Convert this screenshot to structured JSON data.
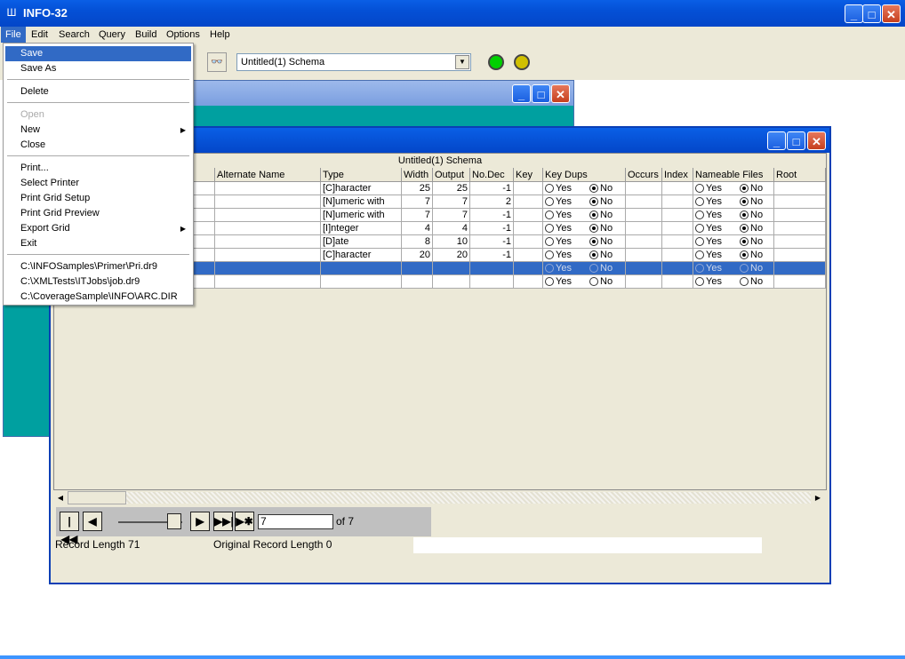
{
  "app": {
    "title": "INFO-32"
  },
  "menubar": [
    "File",
    "Edit",
    "Search",
    "Query",
    "Build",
    "Options",
    "Help"
  ],
  "toolbar": {
    "schema_selector": "Untitled(1) Schema"
  },
  "file_menu": {
    "items": [
      "Save",
      "Save As",
      "Delete",
      "Open",
      "New",
      "Close",
      "Print...",
      "Select Printer",
      "Print Grid Setup",
      "Print Grid Preview",
      "Export Grid",
      "Exit"
    ],
    "recent": [
      "C:\\INFOSamples\\Primer\\Pri.dr9",
      "C:\\XMLTests\\ITJobs\\job.dr9",
      "C:\\CoverageSample\\INFO\\ARC.DIR"
    ]
  },
  "grid": {
    "title": "Untitled(1) Schema",
    "columns": [
      "Alternate Name",
      "Type",
      "Width",
      "Output",
      "No.Dec",
      "Key",
      "Key Dups",
      "Occurs",
      "Index",
      "Nameable Files",
      "Root"
    ],
    "rows": [
      {
        "type": "[C]haracter",
        "width": "25",
        "output": "25",
        "nodec": "-1",
        "keydups": "No",
        "nameable": "No"
      },
      {
        "type": "[N]umeric with",
        "width": "7",
        "output": "7",
        "nodec": "2",
        "keydups": "No",
        "nameable": "No"
      },
      {
        "type": "[N]umeric with",
        "width": "7",
        "output": "7",
        "nodec": "-1",
        "keydups": "No",
        "nameable": "No"
      },
      {
        "type": "[I]nteger",
        "width": "4",
        "output": "4",
        "nodec": "-1",
        "keydups": "No",
        "nameable": "No"
      },
      {
        "type": "[D]ate",
        "width": "8",
        "output": "10",
        "nodec": "-1",
        "keydups": "No",
        "nameable": "No"
      },
      {
        "type": "[C]haracter",
        "width": "20",
        "output": "20",
        "nodec": "-1",
        "keydups": "No",
        "nameable": "No"
      },
      {
        "type": "",
        "width": "",
        "output": "",
        "nodec": "",
        "keydups": "",
        "nameable": ""
      },
      {
        "type": "",
        "width": "",
        "output": "",
        "nodec": "",
        "keydups": "",
        "nameable": ""
      }
    ],
    "radio_labels": {
      "yes": "Yes",
      "no": "No"
    }
  },
  "navigation": {
    "current_record": "7",
    "of_text": "of 7"
  },
  "status": {
    "record_length": "Record Length 71",
    "original_record_length": "Original Record Length 0"
  }
}
